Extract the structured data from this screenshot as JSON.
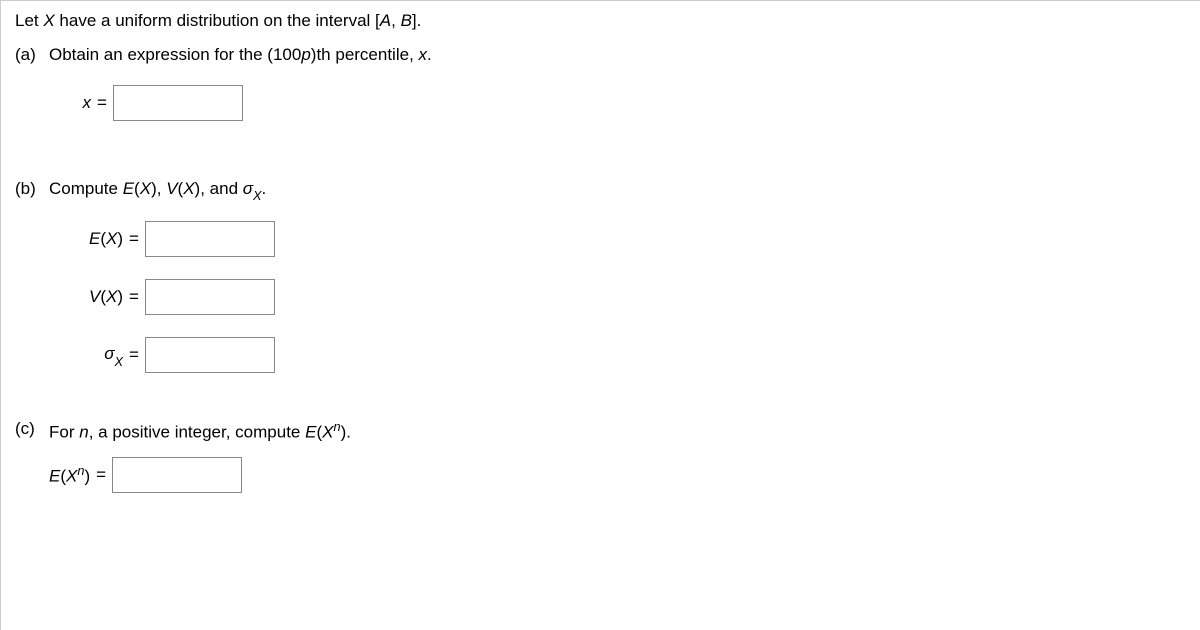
{
  "intro": {
    "pre": "Let ",
    "var": "X",
    "mid": " have a uniform distribution on the interval [",
    "A": "A",
    "comma": ", ",
    "B": "B",
    "post": "]."
  },
  "parts": {
    "a": {
      "label": "(a)",
      "prompt_pre": "Obtain an expression for the (100",
      "prompt_p": "p",
      "prompt_mid": ")th percentile, ",
      "prompt_x": "x",
      "prompt_post": ".",
      "eq_lhs": "x",
      "eq_sign": "="
    },
    "b": {
      "label": "(b)",
      "prompt_pre": "Compute ",
      "e_label": "E",
      "paren_open": "(",
      "X": "X",
      "paren_close": ")",
      "sep": ", ",
      "v_label": "V",
      "and": ", and ",
      "sigma": "σ",
      "sub_x": "X",
      "period": ".",
      "rows": {
        "ex": {
          "sym": "E",
          "var": "X",
          "sign": "="
        },
        "vx": {
          "sym": "V",
          "var": "X",
          "sign": "="
        },
        "sx": {
          "sigma": "σ",
          "sub": "X",
          "sign": "="
        }
      }
    },
    "c": {
      "label": "(c)",
      "prompt_pre": "For ",
      "n": "n",
      "prompt_mid": ", a positive integer, compute ",
      "e_label": "E",
      "paren_open": "(",
      "X": "X",
      "sup_n": "n",
      "paren_close": ")",
      "period": ".",
      "row": {
        "sym": "E",
        "var": "X",
        "sup": "n",
        "sign": "="
      }
    }
  }
}
